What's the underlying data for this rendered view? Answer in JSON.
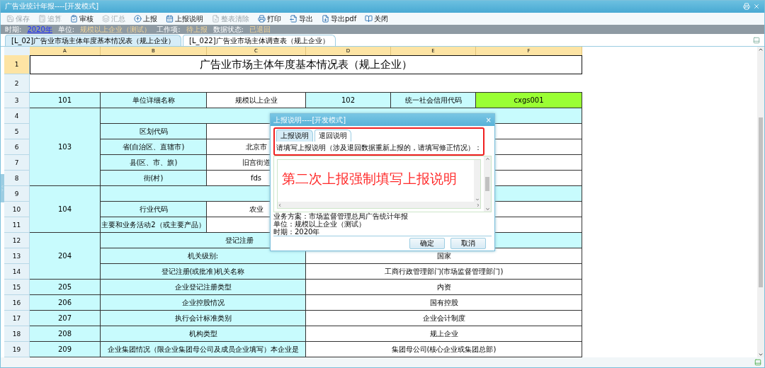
{
  "window": {
    "title": "广告业统计年报----[开发模式]"
  },
  "toolbar": [
    {
      "label": "保存",
      "disabled": true
    },
    {
      "label": "追算",
      "disabled": true
    },
    {
      "label": "审核",
      "disabled": false
    },
    {
      "label": "汇总",
      "disabled": true
    },
    {
      "label": "上报",
      "disabled": false
    },
    {
      "label": "上报说明",
      "disabled": false
    },
    {
      "label": "整表清除",
      "disabled": true
    },
    {
      "label": "打印",
      "disabled": false
    },
    {
      "label": "导出",
      "disabled": false
    },
    {
      "label": "导出pdf",
      "disabled": false
    },
    {
      "label": "关闭",
      "disabled": false
    }
  ],
  "info_bar": {
    "period_label": "时期:",
    "period": "2020年",
    "unit_label": "单位:",
    "unit": "规模以上企业（测试）",
    "work_label": "工作项:",
    "work": "待上报",
    "state_label": "数据状态:",
    "state": "已退回"
  },
  "sheet_tabs": [
    {
      "label": "[L_02]广告业市场主体年度基本情况表（规上企业）",
      "selected": true
    },
    {
      "label": "[L_022]广告业市场主体调查表（规上企业）",
      "selected": false
    }
  ],
  "sheet": {
    "columns": [
      "A",
      "B",
      "C",
      "D",
      "E",
      "F"
    ],
    "rows": [
      {
        "header": "1",
        "selected": true,
        "title": "广告业市场主体年度基本情况表（规上企业）"
      },
      {
        "header": "2",
        "selected": false
      },
      {
        "header": "3",
        "selected": false,
        "a": "101",
        "b": "单位详细名称",
        "c": "规模以上企业",
        "d": "102",
        "e": "统一社会信用代码",
        "f": "cxgs001"
      },
      {
        "header": "4",
        "selected": false,
        "a": "103"
      },
      {
        "header": "5",
        "selected": false,
        "b": "区划代码"
      },
      {
        "header": "6",
        "selected": false,
        "b": "省(自治区、直辖市)",
        "c": "北京市"
      },
      {
        "header": "7",
        "selected": false,
        "b": "县(区、市、旗)",
        "c": "旧宫街道"
      },
      {
        "header": "8",
        "selected": false,
        "b": "街(村)",
        "c": "fds"
      },
      {
        "header": "9",
        "selected": false,
        "a": "104"
      },
      {
        "header": "10",
        "selected": false,
        "b": "行业代码",
        "c": "农业"
      },
      {
        "header": "11",
        "selected": false,
        "b": "主要和业务活动2（或主要产品）"
      },
      {
        "header": "12",
        "selected": false,
        "a": "204",
        "b": "登记注册"
      },
      {
        "header": "13",
        "selected": false,
        "b": "机关级别:",
        "d": "国家"
      },
      {
        "header": "14",
        "selected": false,
        "b": "登记注册(或批准)机关名称",
        "d": "工商行政管理部门(市场监督管理部门)"
      },
      {
        "header": "15",
        "selected": false,
        "a": "205",
        "b": "企业登记注册类型",
        "d": "内资"
      },
      {
        "header": "16",
        "selected": false,
        "a": "206",
        "b": "企业控股情况",
        "d": "国有控股"
      },
      {
        "header": "17",
        "selected": false,
        "a": "207",
        "b": "执行会计标准类别",
        "d": "企业会计制度"
      },
      {
        "header": "18",
        "selected": false,
        "a": "208",
        "b": "机构类型",
        "d": "规上企业"
      },
      {
        "header": "19",
        "selected": false,
        "a": "209",
        "b": "企业集团情况（限企业集团母公司及成员企业填写）本企业是",
        "d": "集团母公司(核心企业或集团总部)"
      }
    ]
  },
  "dialog": {
    "title": "上报说明----[开发模式]",
    "close": "×",
    "tabs": [
      {
        "label": "上报说明",
        "selected": true
      },
      {
        "label": "退回说明",
        "selected": false
      }
    ],
    "prompt": "请填写上报说明（涉及退回数据重新上报的，请填写修正情况）：",
    "value": "第二次上报强制填写上报说明",
    "info": [
      "业务方案：市场监督管理总局广告统计年报",
      "单位：规模以上企业（测试）",
      "时期：2020年"
    ],
    "buttons": [
      "确定",
      "取消"
    ]
  }
}
